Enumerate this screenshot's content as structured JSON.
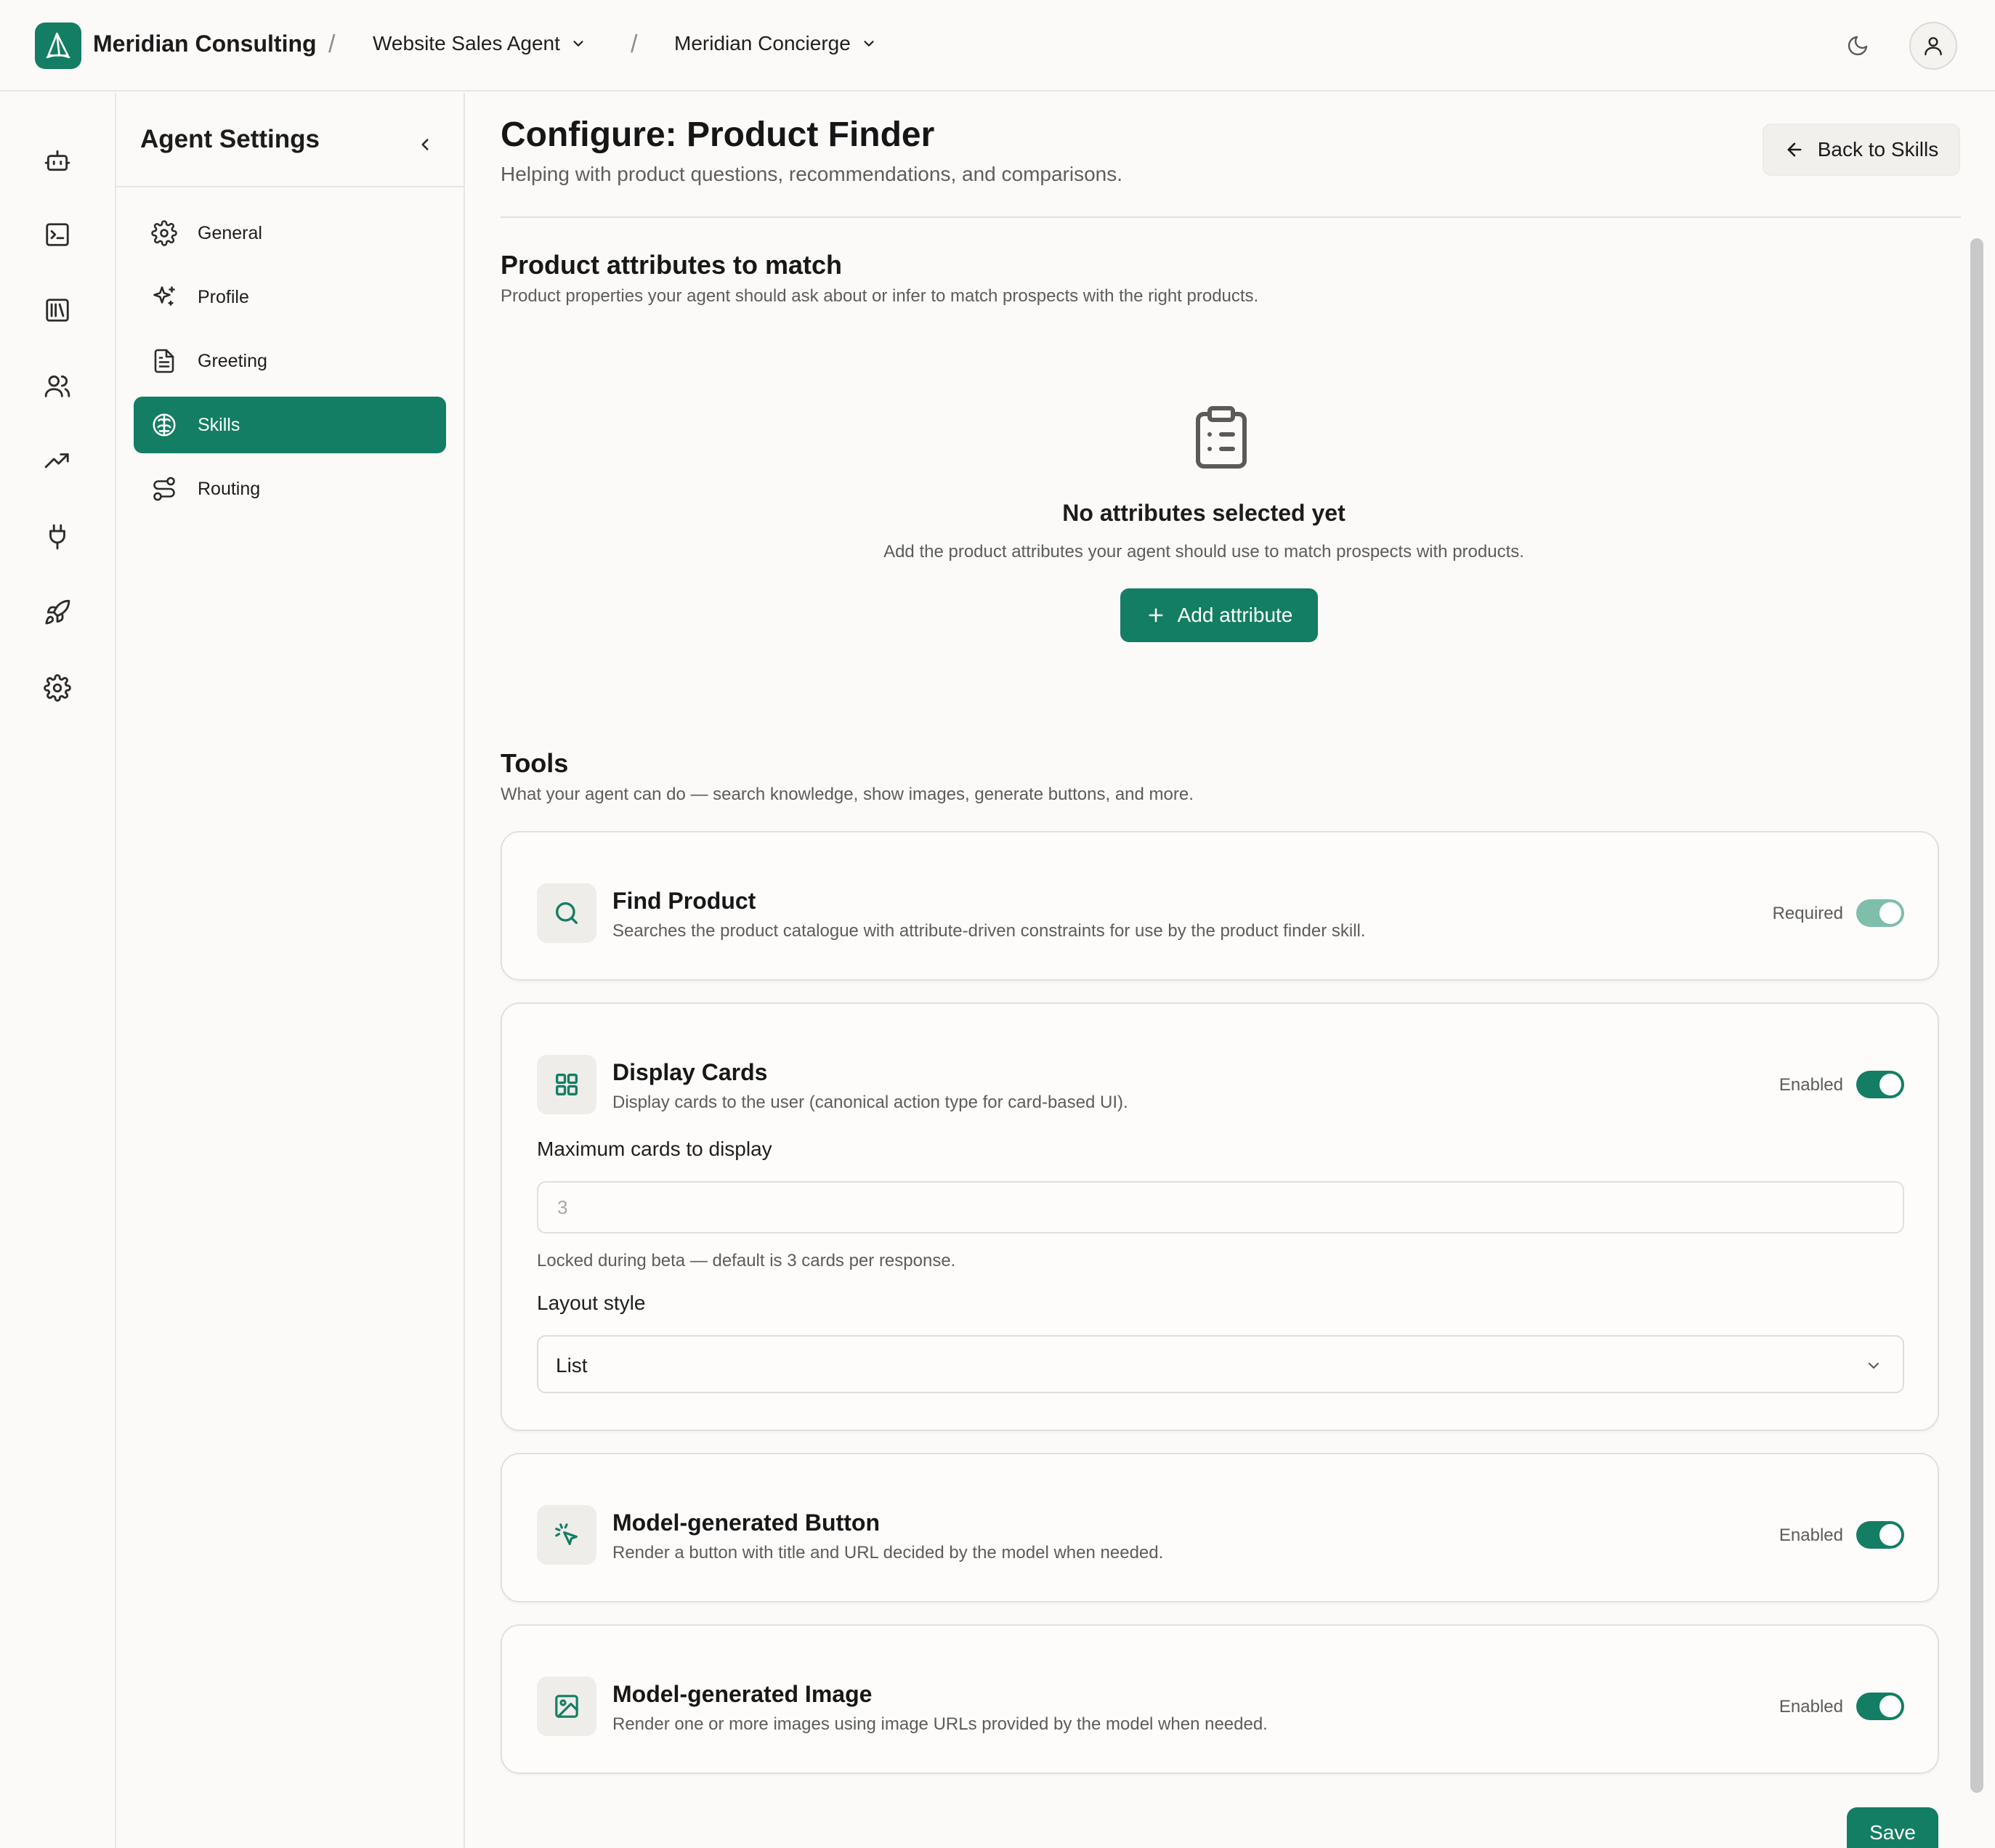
{
  "header": {
    "brand": "Meridian Consulting",
    "separator": "/",
    "crumb_agent": "Website Sales Agent",
    "crumb_config": "Meridian Concierge",
    "theme_toggle_icon": "moon-icon",
    "account_icon": "user-icon"
  },
  "rail": {
    "items": [
      "bot-icon",
      "terminal-icon",
      "library-icon",
      "users-icon",
      "trending-up-icon",
      "plug-icon",
      "rocket-icon",
      "settings-icon"
    ]
  },
  "settings_sidebar": {
    "title": "Agent Settings",
    "items": [
      {
        "label": "General",
        "icon": "gear-icon"
      },
      {
        "label": "Profile",
        "icon": "sparkles-icon"
      },
      {
        "label": "Greeting",
        "icon": "document-icon"
      },
      {
        "label": "Skills",
        "icon": "brain-icon",
        "active": true
      },
      {
        "label": "Routing",
        "icon": "route-icon"
      }
    ]
  },
  "page": {
    "title": "Configure: Product Finder",
    "subtitle": "Helping with product questions, recommendations, and comparisons.",
    "back_label": "Back to Skills"
  },
  "attributes": {
    "title": "Product attributes to match",
    "subtitle": "Product properties your agent should ask about or infer to match prospects with the right products.",
    "empty_title": "No attributes selected yet",
    "empty_sub": "Add the product attributes your agent should use to match prospects with products.",
    "add_label": "Add attribute"
  },
  "tools": {
    "title": "Tools",
    "subtitle": "What your agent can do — search knowledge, show images, generate buttons, and more.",
    "find_product": {
      "name": "Find Product",
      "desc": "Searches the product catalogue with attribute-driven constraints for use by the product finder skill.",
      "state": "Required",
      "on": true
    },
    "display_cards": {
      "name": "Display Cards",
      "desc": "Display cards to the user (canonical action type for card-based UI).",
      "state": "Enabled",
      "on": true,
      "max_label": "Maximum cards to display",
      "max_value": "3",
      "max_help": "Locked during beta — default is 3 cards per response.",
      "layout_label": "Layout style",
      "layout_value": "List"
    },
    "button": {
      "name": "Model-generated Button",
      "desc": "Render a button with title and URL decided by the model when needed.",
      "state": "Enabled",
      "on": true
    },
    "image": {
      "name": "Model-generated Image",
      "desc": "Render one or more images using image URLs provided by the model when needed.",
      "state": "Enabled",
      "on": true
    }
  },
  "footer": {
    "save_label": "Save"
  },
  "colors": {
    "accent": "#137e63",
    "accent_dim": "#7fbeaa",
    "background": "#fbfaf8"
  }
}
